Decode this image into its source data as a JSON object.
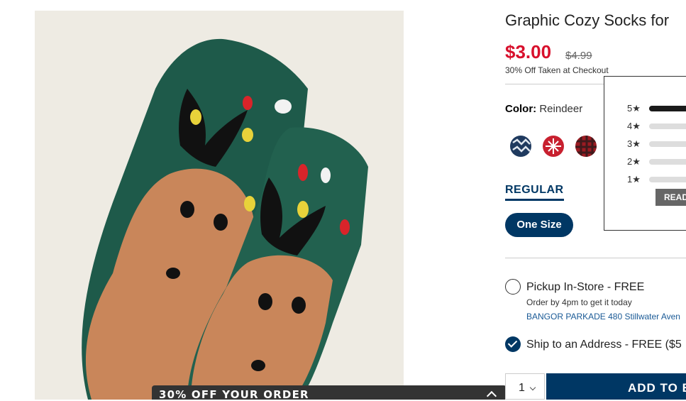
{
  "product": {
    "title": "Graphic Cozy Socks for",
    "sale_price": "$3.00",
    "original_price": "$4.99",
    "discount_note": "30% Off Taken at Checkout"
  },
  "color": {
    "label": "Color:",
    "value": "Reindeer",
    "swatches": [
      {
        "name": "navy-pattern",
        "color": "#1f3a5f"
      },
      {
        "name": "red-white-pattern",
        "color": "#c8202f"
      },
      {
        "name": "red-plaid",
        "color": "#9b1b22"
      }
    ]
  },
  "fit_tab": "REGULAR",
  "size": "One Size",
  "fulfillment": {
    "pickup_label": "Pickup In-Store - FREE",
    "pickup_sub": "Order by 4pm to get it today",
    "pickup_store": "BANGOR PARKADE 480 Stillwater Aven",
    "ship_label": "Ship to an Address - FREE ($5"
  },
  "cart": {
    "quantity": "1",
    "add_button": "ADD TO B"
  },
  "promo": {
    "text": "30% OFF YOUR ORDER"
  },
  "ratings": {
    "rows": [
      {
        "star": "5★",
        "fill": 1.0
      },
      {
        "star": "4★",
        "fill": 0.0
      },
      {
        "star": "3★",
        "fill": 0.0
      },
      {
        "star": "2★",
        "fill": 0.0
      },
      {
        "star": "1★",
        "fill": 0.0
      }
    ],
    "read_button": "READ"
  },
  "colors": {
    "brand_navy": "#003764",
    "sale_red": "#d8102c",
    "sock_green": "#1e5a4a",
    "reindeer_tan": "#c9865a"
  }
}
